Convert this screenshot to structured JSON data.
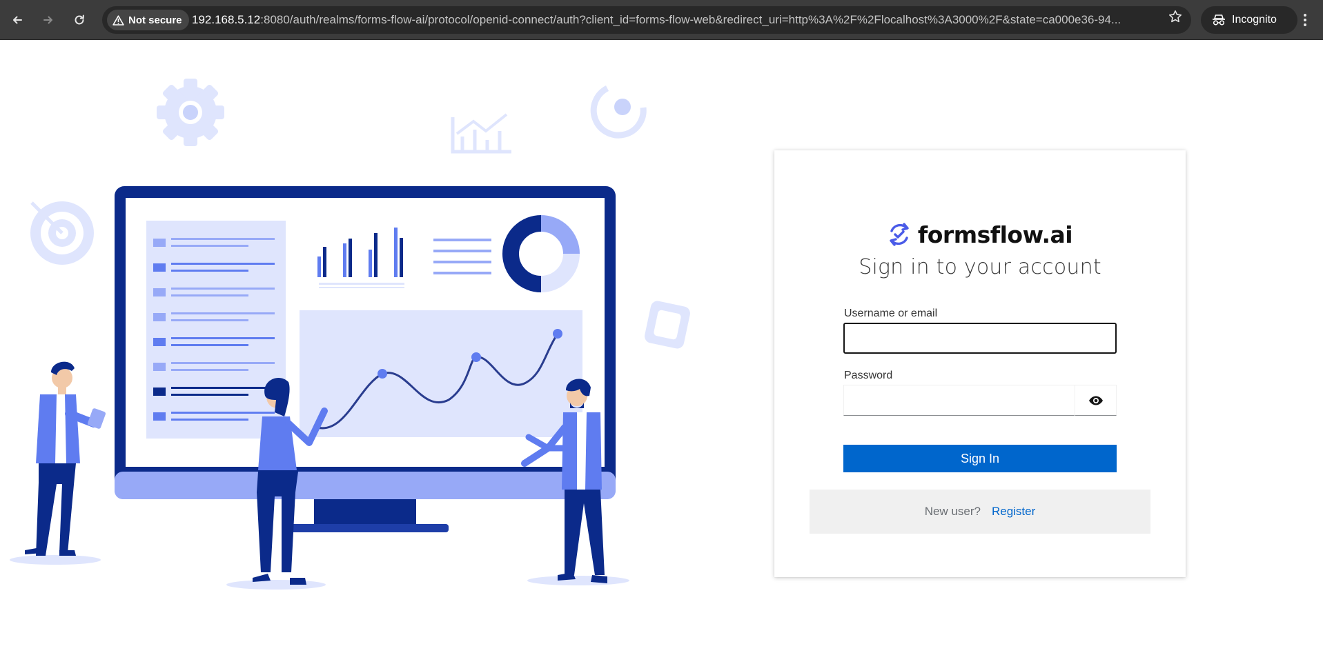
{
  "browser": {
    "security_label": "Not secure",
    "url_host": "192.168.5.12",
    "url_rest": ":8080/auth/realms/forms-flow-ai/protocol/openid-connect/auth?client_id=forms-flow-web&redirect_uri=http%3A%2F%2Flocalhost%3A3000%2F&state=ca000e36-94...",
    "incognito_label": "Incognito",
    "icons": {
      "back": "back-arrow-icon",
      "forward": "forward-arrow-icon",
      "reload": "reload-icon",
      "warning": "warning-triangle-icon",
      "bookmark": "star-icon",
      "incognito": "incognito-icon",
      "menu": "kebab-menu-icon"
    }
  },
  "login": {
    "brand_name": "formsflow.ai",
    "title": "Sign in to your account",
    "username_label": "Username or email",
    "username_value": "",
    "password_label": "Password",
    "password_value": "",
    "signin_label": "Sign In",
    "new_user_text": "New user?",
    "register_label": "Register"
  },
  "colors": {
    "primary": "#0066cc",
    "illustration_dark": "#0b2a8a",
    "illustration_mid": "#5f7cf0",
    "illustration_light": "#dfe5fd",
    "chrome_bg": "#3c3c3c"
  }
}
